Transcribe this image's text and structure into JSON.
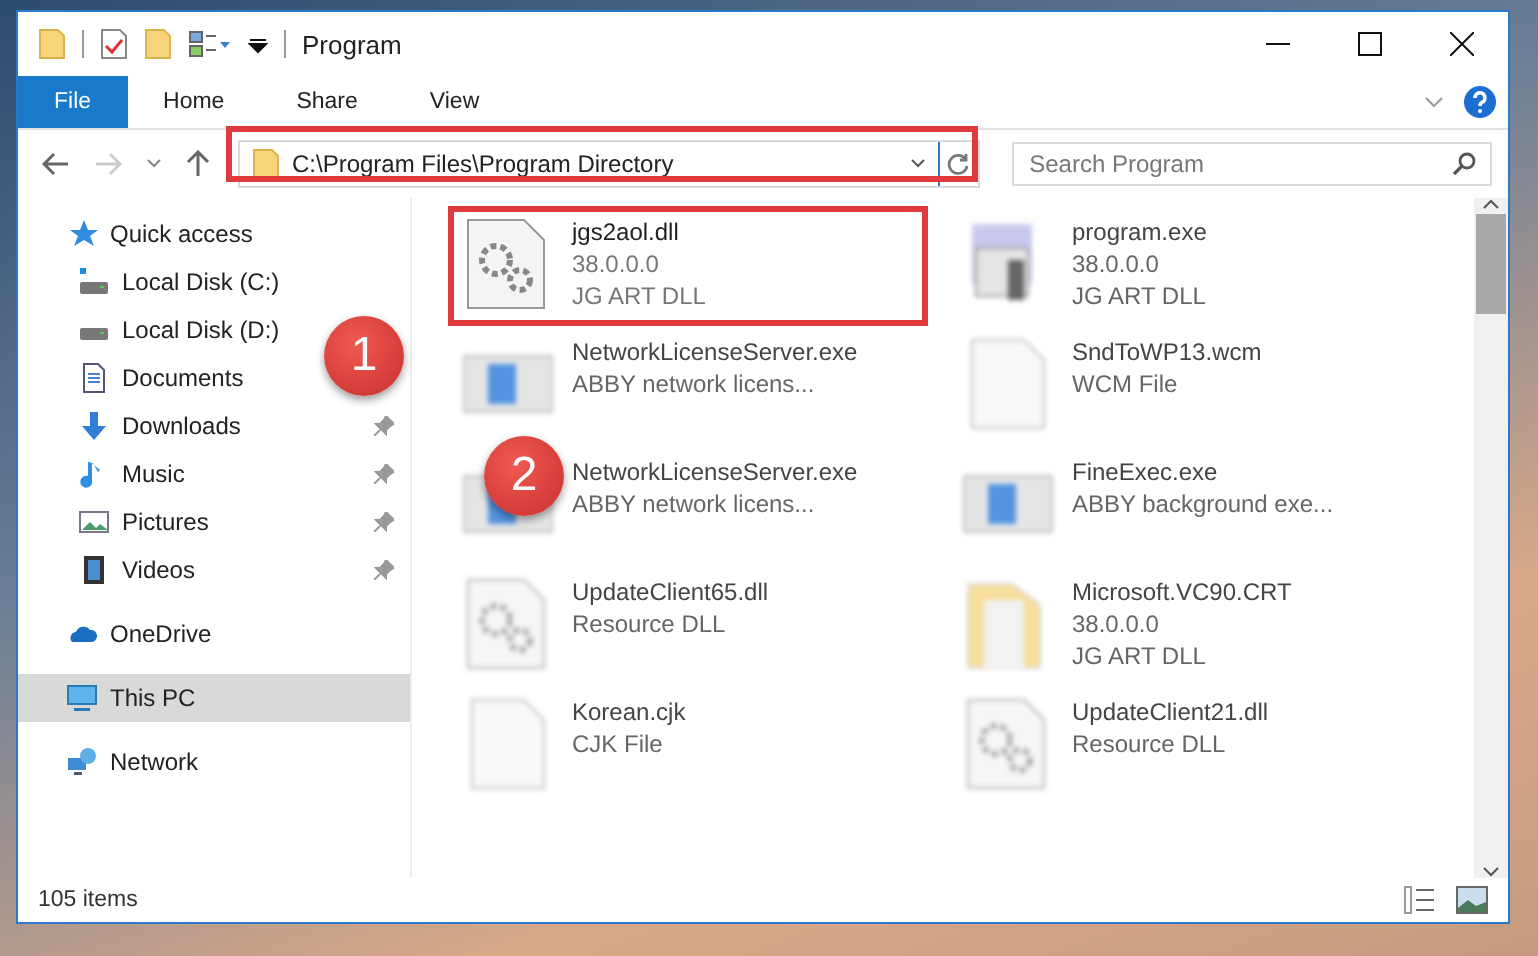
{
  "window": {
    "title": "Program"
  },
  "ribbon_tabs": [
    {
      "label": "File",
      "selected": true
    },
    {
      "label": "Home",
      "selected": false
    },
    {
      "label": "Share",
      "selected": false
    },
    {
      "label": "View",
      "selected": false
    }
  ],
  "address_bar": {
    "value": "C:\\Program Files\\Program Directory"
  },
  "search": {
    "placeholder": "Search Program"
  },
  "sidebar": {
    "items": [
      {
        "label": "Quick access",
        "kind": "star",
        "selected": false,
        "pinned": false,
        "children": [
          {
            "label": "Local Disk (C:)",
            "kind": "drive-c",
            "selected": false,
            "pinned": false
          },
          {
            "label": "Local Disk (D:)",
            "kind": "drive",
            "selected": false,
            "pinned": false
          },
          {
            "label": "Documents",
            "kind": "document",
            "selected": false,
            "pinned": false
          },
          {
            "label": "Downloads",
            "kind": "download",
            "selected": false,
            "pinned": true
          },
          {
            "label": "Music",
            "kind": "music",
            "selected": false,
            "pinned": true
          },
          {
            "label": "Pictures",
            "kind": "picture",
            "selected": false,
            "pinned": true
          },
          {
            "label": "Videos",
            "kind": "video",
            "selected": false,
            "pinned": true
          }
        ]
      },
      {
        "label": "OneDrive",
        "kind": "cloud",
        "selected": false,
        "pinned": false
      },
      {
        "label": "This PC",
        "kind": "pc",
        "selected": true,
        "pinned": false
      },
      {
        "label": "Network",
        "kind": "network",
        "selected": false,
        "pinned": false
      }
    ]
  },
  "files": [
    {
      "name": "jgs2aol.dll",
      "details": [
        "38.0.0.0",
        "JG ART DLL"
      ],
      "kind": "dll",
      "blurred": false,
      "highlighted": true
    },
    {
      "name": "program.exe",
      "details": [
        "38.0.0.0",
        "JG ART DLL"
      ],
      "kind": "program",
      "blurred": true,
      "highlighted": false
    },
    {
      "name": "NetworkLicenseServer.exe",
      "details": [
        "ABBY network licens..."
      ],
      "kind": "app",
      "blurred": true,
      "highlighted": false
    },
    {
      "name": "SndToWP13.wcm",
      "details": [
        "WCM File"
      ],
      "kind": "document",
      "blurred": true,
      "highlighted": false
    },
    {
      "name": "NetworkLicenseServer.exe",
      "details": [
        "ABBY network licens..."
      ],
      "kind": "app",
      "blurred": true,
      "highlighted": false
    },
    {
      "name": "FineExec.exe",
      "details": [
        "ABBY background exe..."
      ],
      "kind": "app",
      "blurred": true,
      "highlighted": false
    },
    {
      "name": "UpdateClient65.dll",
      "details": [
        "Resource DLL"
      ],
      "kind": "dll",
      "blurred": true,
      "highlighted": false
    },
    {
      "name": "Microsoft.VC90.CRT",
      "details": [
        "38.0.0.0",
        "JG ART DLL"
      ],
      "kind": "folder",
      "blurred": true,
      "highlighted": false
    },
    {
      "name": "Korean.cjk",
      "details": [
        "CJK File"
      ],
      "kind": "document",
      "blurred": true,
      "highlighted": false
    },
    {
      "name": "UpdateClient21.dll",
      "details": [
        "Resource DLL"
      ],
      "kind": "dll",
      "blurred": true,
      "highlighted": false
    }
  ],
  "status_bar": {
    "item_count": "105 items"
  },
  "annotations": [
    {
      "number": "1"
    },
    {
      "number": "2"
    }
  ]
}
